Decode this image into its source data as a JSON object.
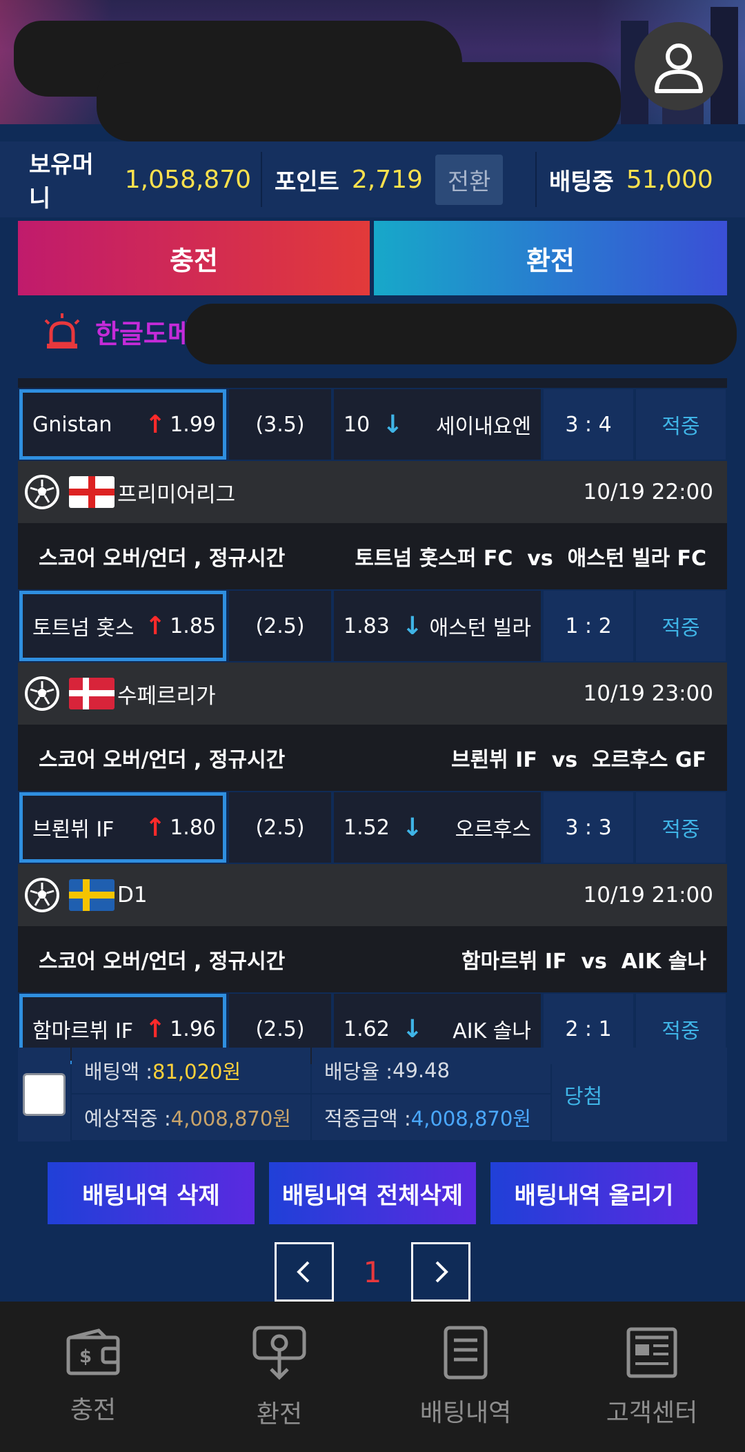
{
  "header": {
    "avatar_icon": "user-icon"
  },
  "wallet": {
    "money_label": "보유머니",
    "money_value": "1,058,870",
    "point_label": "포인트",
    "point_value": "2,719",
    "convert_label": "전환",
    "betting_label": "배팅중",
    "betting_value": "51,000"
  },
  "actions": {
    "charge_label": "충전",
    "exchange_label": "환전"
  },
  "notice": {
    "text": "한글도메인"
  },
  "bets": [
    {
      "league": null,
      "home": "Gnistan",
      "home_odd": "1.99",
      "line": "(3.5)",
      "away_odd": "10",
      "away": "세이내요엔",
      "score": "3 : 4",
      "result": "적중"
    },
    {
      "league": {
        "name": "프리미어리그",
        "time": "10/19 22:00",
        "flag": "england"
      },
      "market": "스코어 오버/언더 , 정규시간",
      "matchup": "토트넘 홋스퍼 FC  vs  애스턴 빌라 FC",
      "home": "토트넘 홋스",
      "home_odd": "1.85",
      "line": "(2.5)",
      "away_odd": "1.83",
      "away": "애스턴 빌라",
      "score": "1 : 2",
      "result": "적중"
    },
    {
      "league": {
        "name": "수페르리가",
        "time": "10/19 23:00",
        "flag": "denmark"
      },
      "market": "스코어 오버/언더 , 정규시간",
      "matchup": "브뢴뷔 IF  vs  오르후스 GF",
      "home": "브뢴뷔 IF",
      "home_odd": "1.80",
      "line": "(2.5)",
      "away_odd": "1.52",
      "away": "오르후스",
      "score": "3 : 3",
      "result": "적중"
    },
    {
      "league": {
        "name": "D1",
        "time": "10/19 21:00",
        "flag": "sweden"
      },
      "market": "스코어 오버/언더 , 정규시간",
      "matchup": "함마르뷔 IF  vs  AIK 솔나",
      "home": "함마르뷔 IF",
      "home_odd": "1.96",
      "line": "(2.5)",
      "away_odd": "1.62",
      "away": "AIK 솔나",
      "score": "2 : 1",
      "result": "적중"
    }
  ],
  "summary": {
    "bet_amount_label": "배팅액 :",
    "bet_amount": "81,020원",
    "odds_label": "배당율 :",
    "odds": "49.48",
    "expected_label": "예상적중 :",
    "expected": "4,008,870원",
    "win_amount_label": "적중금액 :",
    "win_amount": "4,008,870원",
    "result": "당첨"
  },
  "history_actions": {
    "delete": "배팅내역 삭제",
    "delete_all": "배팅내역 전체삭제",
    "post": "배팅내역 올리기"
  },
  "pager": {
    "current": "1"
  },
  "bottom_nav": [
    {
      "label": "충전",
      "icon": "wallet-icon"
    },
    {
      "label": "환전",
      "icon": "exchange-icon"
    },
    {
      "label": "배팅내역",
      "icon": "document-icon"
    },
    {
      "label": "고객센터",
      "icon": "newspaper-icon"
    }
  ],
  "colors": {
    "accent_yellow": "#ffe14d",
    "win_blue": "#3fb4e6",
    "odd_up": "#ff2a2a",
    "page_num": "#e8383d"
  }
}
